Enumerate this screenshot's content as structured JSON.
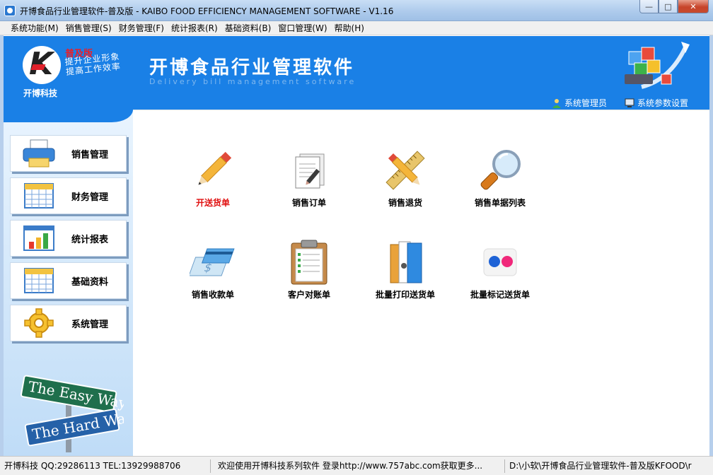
{
  "window": {
    "title": "开博食品行业管理软件-普及版 - KAIBO FOOD EFFICIENCY MANAGEMENT SOFTWARE - V1.16",
    "minimize_glyph": "—",
    "maximize_glyph": "□",
    "close_glyph": "✕"
  },
  "menu": [
    {
      "label": "系统功能(M)"
    },
    {
      "label": "销售管理(S)"
    },
    {
      "label": "财务管理(F)"
    },
    {
      "label": "统计报表(R)"
    },
    {
      "label": "基础资料(B)"
    },
    {
      "label": "窗口管理(W)"
    },
    {
      "label": "帮助(H)"
    }
  ],
  "header": {
    "edition": "普及版",
    "slogan_line1": "提升企业形象",
    "slogan_line2": "提高工作效率",
    "company": "开博科技",
    "title": "开博食品行业管理软件",
    "subtitle": "Delivery bill management software",
    "user_link": "系统管理员",
    "settings_link": "系统参数设置",
    "brand_color": "#1a80e6"
  },
  "sidebar": {
    "items": [
      {
        "label": "销售管理",
        "icon": "printer-icon"
      },
      {
        "label": "财务管理",
        "icon": "calendar-icon"
      },
      {
        "label": "统计报表",
        "icon": "bar-chart-icon"
      },
      {
        "label": "基础资料",
        "icon": "calendar-icon"
      },
      {
        "label": "系统管理",
        "icon": "gear-icon"
      }
    ],
    "sign_top": "The Easy Way",
    "sign_bottom": "The Hard Way"
  },
  "tiles": [
    {
      "label": "开送货单",
      "icon": "pencil-icon",
      "active": true
    },
    {
      "label": "销售订单",
      "icon": "document-edit-icon",
      "active": false
    },
    {
      "label": "销售退货",
      "icon": "ruler-pencil-icon",
      "active": false
    },
    {
      "label": "销售单据列表",
      "icon": "magnifier-icon",
      "active": false
    },
    {
      "label": "销售收款单",
      "icon": "payment-card-icon",
      "active": false
    },
    {
      "label": "客户对账单",
      "icon": "clipboard-icon",
      "active": false
    },
    {
      "label": "批量打印送货单",
      "icon": "binders-icon",
      "active": false
    },
    {
      "label": "批量标记送货单",
      "icon": "dots-icon",
      "active": false
    }
  ],
  "status": {
    "contact": "开博科技 QQ:29286113 TEL:13929988706",
    "welcome": "欢迎使用开博科技系列软件   登录http://www.757abc.com获取更多...",
    "path": "D:\\小软\\开博食品行业管理软件-普及版KFOOD\\r"
  }
}
